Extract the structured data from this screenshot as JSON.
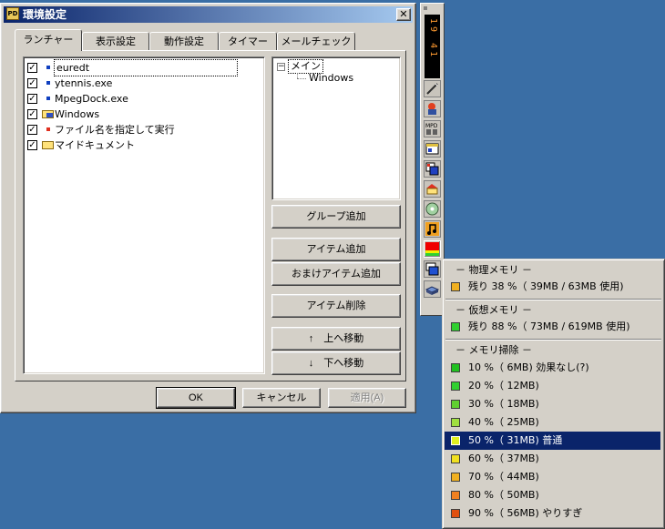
{
  "dialog": {
    "title": "環境設定",
    "app_icon_text": "PD",
    "close_symbol": "✕",
    "tabs": [
      "ランチャー",
      "表示設定",
      "動作設定",
      "タイマー",
      "メールチェック"
    ],
    "active_tab": 0,
    "launcher_items": [
      {
        "label": "euredt",
        "checked": true,
        "icon": "exe-icon"
      },
      {
        "label": "ytennis.exe",
        "checked": true,
        "icon": "exe-icon"
      },
      {
        "label": "MpegDock.exe",
        "checked": true,
        "icon": "exe-icon"
      },
      {
        "label": "Windows",
        "checked": true,
        "icon": "windows-folder-icon"
      },
      {
        "label": "ファイル名を指定して実行",
        "checked": true,
        "icon": "run-icon"
      },
      {
        "label": "マイドキュメント",
        "checked": true,
        "icon": "folder-icon"
      }
    ],
    "check_mark": "✓",
    "tree": {
      "expander": "−",
      "root": "メイン",
      "child": "Windows"
    },
    "buttons": {
      "add_group": "グループ追加",
      "add_item": "アイテム追加",
      "add_extra_item": "おまけアイテム追加",
      "delete_item": "アイテム削除",
      "move_up": "↑　上へ移動",
      "move_down": "↓　下へ移動"
    },
    "footer": {
      "ok": "OK",
      "cancel": "キャンセル",
      "apply": "適用(A)"
    }
  },
  "dock": {
    "clock": "19 41",
    "icons": [
      "pen-icon",
      "character-icon",
      "mpd-icon",
      "window-app-icon",
      "window-list-icon",
      "home-folder-icon",
      "cd-icon",
      "music-icon",
      "memory-meter-icon",
      "windows-icon",
      "drive-icon"
    ]
  },
  "menu": {
    "physical_header": "－ 物理メモリ －",
    "physical_item": "残り 38 %（ 39MB / 63MB 使用)",
    "virtual_header": "－ 仮想メモリ －",
    "virtual_item": "残り 88 %（ 73MB / 619MB 使用)",
    "clean_header": "－ メモリ掃除 －",
    "clean_items": [
      {
        "label": "10 %（ 6MB) 効果なし(?)",
        "color": "#20c020"
      },
      {
        "label": "20 %（ 12MB)",
        "color": "#30d030"
      },
      {
        "label": "30 %（ 18MB)",
        "color": "#60d030"
      },
      {
        "label": "40 %（ 25MB)",
        "color": "#a0e040"
      },
      {
        "label": "50 %（ 31MB) 普通",
        "color": "#e0f020"
      },
      {
        "label": "60 %（ 37MB)",
        "color": "#f0e020"
      },
      {
        "label": "70 %（ 44MB)",
        "color": "#f0b020"
      },
      {
        "label": "80 %（ 50MB)",
        "color": "#f08020"
      },
      {
        "label": "90 %（ 56MB) やりすぎ",
        "color": "#e05010"
      }
    ],
    "selected_index": 4,
    "physical_color": "#f0b020",
    "virtual_color": "#30d030"
  }
}
